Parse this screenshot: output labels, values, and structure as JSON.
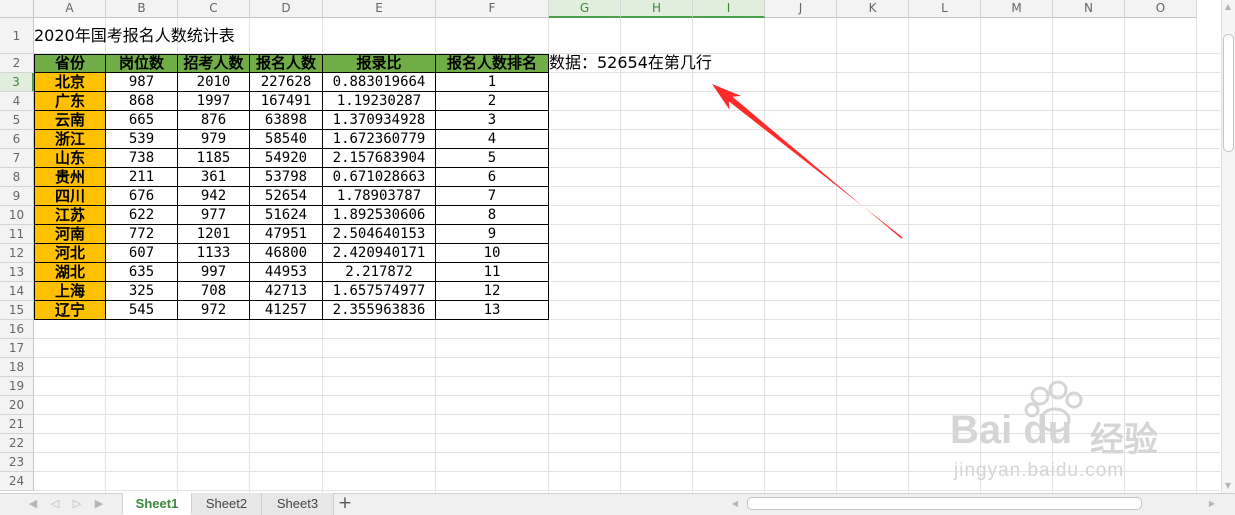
{
  "columns": [
    "A",
    "B",
    "C",
    "D",
    "E",
    "F",
    "G",
    "H",
    "I",
    "J",
    "K",
    "L",
    "M",
    "N",
    "O"
  ],
  "rows": [
    "1",
    "2",
    "3",
    "4",
    "5",
    "6",
    "7",
    "8",
    "9",
    "10",
    "11",
    "12",
    "13",
    "14",
    "15",
    "16",
    "17",
    "18",
    "19",
    "20",
    "21",
    "22",
    "23",
    "24"
  ],
  "selected_column": [
    "G",
    "H",
    "I"
  ],
  "selected_row": "3",
  "title": "2020年国考报名人数统计表",
  "headers": [
    "省份",
    "岗位数",
    "招考人数",
    "报名人数",
    "报录比",
    "报名人数排名"
  ],
  "table": [
    [
      "北京",
      "987",
      "2010",
      "227628",
      "0.883019664",
      "1"
    ],
    [
      "广东",
      "868",
      "1997",
      "167491",
      "1.19230287",
      "2"
    ],
    [
      "云南",
      "665",
      "876",
      "63898",
      "1.370934928",
      "3"
    ],
    [
      "浙江",
      "539",
      "979",
      "58540",
      "1.672360779",
      "4"
    ],
    [
      "山东",
      "738",
      "1185",
      "54920",
      "2.157683904",
      "5"
    ],
    [
      "贵州",
      "211",
      "361",
      "53798",
      "0.671028663",
      "6"
    ],
    [
      "四川",
      "676",
      "942",
      "52654",
      "1.78903787",
      "7"
    ],
    [
      "江苏",
      "622",
      "977",
      "51624",
      "1.892530606",
      "8"
    ],
    [
      "河南",
      "772",
      "1201",
      "47951",
      "2.504640153",
      "9"
    ],
    [
      "河北",
      "607",
      "1133",
      "46800",
      "2.420940171",
      "10"
    ],
    [
      "湖北",
      "635",
      "997",
      "44953",
      "2.217872",
      "11"
    ],
    [
      "上海",
      "325",
      "708",
      "42713",
      "1.657574977",
      "12"
    ],
    [
      "辽宁",
      "545",
      "972",
      "41257",
      "2.355963836",
      "13"
    ]
  ],
  "query_label": "数据：52654在第几行",
  "tabs": [
    "Sheet1",
    "Sheet2",
    "Sheet3"
  ],
  "active_tab": "Sheet1",
  "add_sheet": "+",
  "colors": {
    "title_bg": "#ffff00",
    "header_bg": "#70ad47",
    "province_bg": "#ffc000",
    "selection": "#3d9c3d",
    "arrow": "#ff2a2a"
  },
  "icons": {
    "nav_first": "◀",
    "nav_prev": "◁",
    "nav_next": "▷",
    "nav_last": "▶",
    "scroll_up": "▲",
    "scroll_down": "▼",
    "scroll_left": "◀",
    "scroll_right": "▶"
  },
  "watermark": {
    "brand": "Bai du",
    "product": "经验",
    "url": "jingyan.baidu.com"
  }
}
